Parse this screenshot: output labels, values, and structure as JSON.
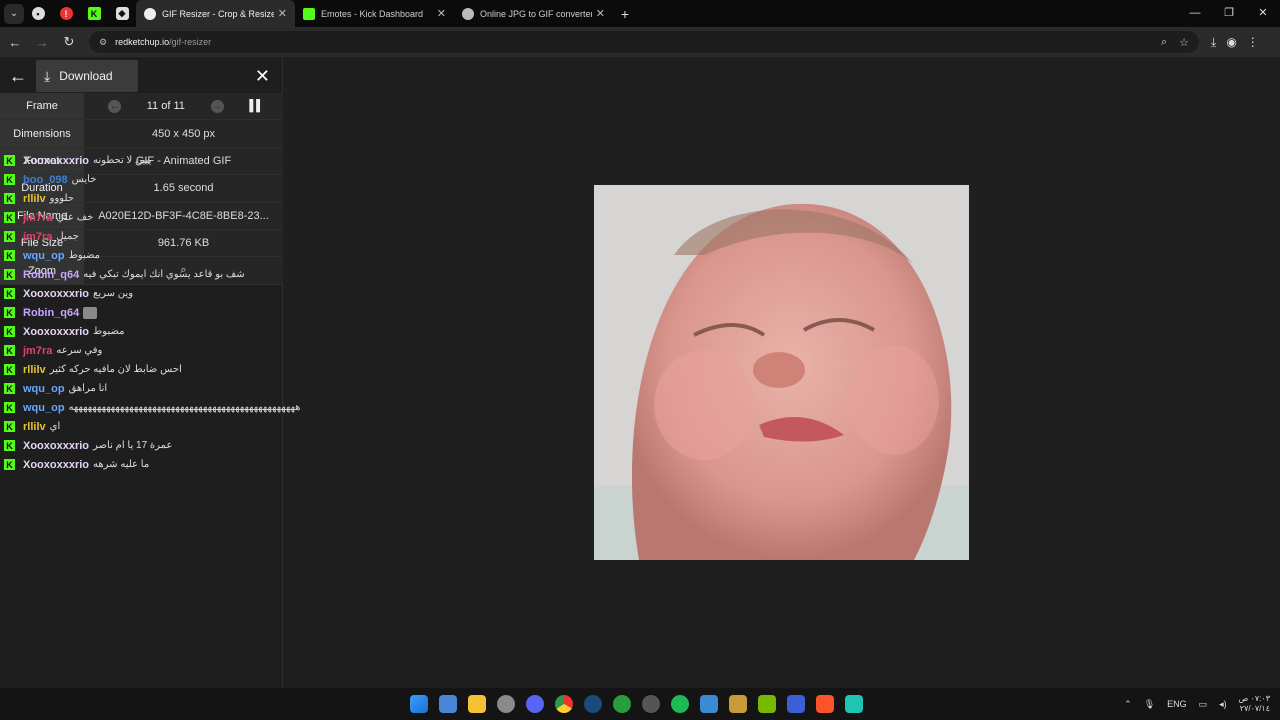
{
  "browser": {
    "tabs": [
      {
        "title": "GIF Resizer - Crop & Resize Anim",
        "active": true,
        "favicon_color": "#e8e8e8"
      },
      {
        "title": "Emotes - Kick Dashboard",
        "active": false,
        "favicon_color": "#53fc18"
      },
      {
        "title": "Online JPG to GIF converter",
        "active": false,
        "favicon_color": "#bbbbbb"
      }
    ],
    "url_site": "redketchup.io",
    "url_path": "/gif-resizer"
  },
  "panel": {
    "download_label": "Download",
    "info": {
      "frame_label": "Frame",
      "frame_value": "11 of 11",
      "dimensions_label": "Dimensions",
      "dimensions_value": "450 x 450 px",
      "format_label": "Format",
      "format_value": "GIF - Animated GIF",
      "duration_label": "Duration",
      "duration_value": "1.65 second",
      "filename_label": "File Name",
      "filename_value": "A020E12D-BF3F-4C8E-8BE8-23...",
      "filesize_label": "File Size",
      "filesize_value": "961.76 KB",
      "zoom_label": "Zoom"
    }
  },
  "chat": [
    {
      "user": "Xooxoxxxrio",
      "color": "#e6d3f5",
      "text": "يبين لا تحطونه"
    },
    {
      "user": "boo_098",
      "color": "#3f7fd6",
      "text": "خايس"
    },
    {
      "user": "rllilv",
      "color": "#e3c23b",
      "text": "حلووو"
    },
    {
      "user": "jm7ra",
      "color": "#e0436a",
      "text": "خف علي"
    },
    {
      "user": "jm7ra",
      "color": "#e0436a",
      "text": "جميل"
    },
    {
      "user": "wqu_op",
      "color": "#6aa7ff",
      "text": "مضبوط"
    },
    {
      "user": "Robin_q64",
      "color": "#c8a6ff",
      "text": "شف بو قاعد يسوي انك ايموك تبكي فيه"
    },
    {
      "user": "Xooxoxxxrio",
      "color": "#e6d3f5",
      "text": "وين سريع"
    },
    {
      "user": "Robin_q64",
      "color": "#c8a6ff",
      "text": ""
    },
    {
      "user": "Xooxoxxxrio",
      "color": "#e6d3f5",
      "text": "مضبوط"
    },
    {
      "user": "jm7ra",
      "color": "#e0436a",
      "text": "وفي سرعه"
    },
    {
      "user": "rllilv",
      "color": "#e3c23b",
      "text": "احس ضابط لان مافيه حركه كثير"
    },
    {
      "user": "wqu_op",
      "color": "#6aa7ff",
      "text": "انا مراهق"
    },
    {
      "user": "wqu_op",
      "color": "#6aa7ff",
      "text": "هههههههههههههههههههههههههههههههههههههههههههههههههه"
    },
    {
      "user": "rllilv",
      "color": "#e3c23b",
      "text": "اي"
    },
    {
      "user": "Xooxoxxxrio",
      "color": "#e6d3f5",
      "text": "عمرة 17 يا ام ناصر"
    },
    {
      "user": "Xooxoxxxrio",
      "color": "#e6d3f5",
      "text": "ما عليه شرهه"
    }
  ],
  "taskbar": {
    "lang": "ENG",
    "time": "٠٧:٠٣ ص",
    "date": "٢٧/٠٧/١٤"
  }
}
